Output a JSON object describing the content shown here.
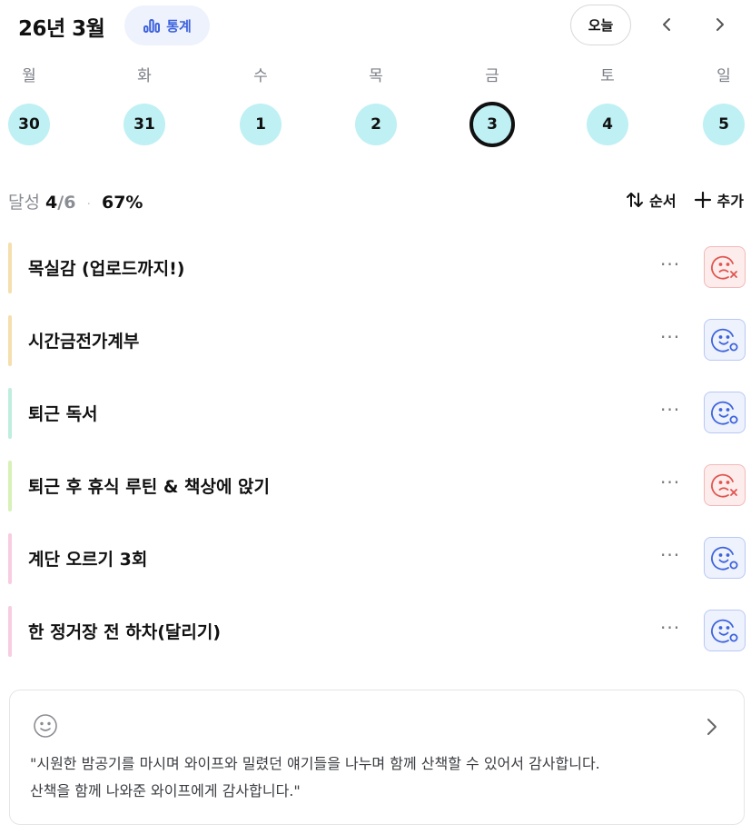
{
  "header": {
    "month_title": "26년 3월",
    "stats_label": "통계",
    "today_label": "오늘"
  },
  "week": {
    "days": [
      {
        "name": "월",
        "date": "30",
        "selected": false
      },
      {
        "name": "화",
        "date": "31",
        "selected": false
      },
      {
        "name": "수",
        "date": "1",
        "selected": false
      },
      {
        "name": "목",
        "date": "2",
        "selected": false
      },
      {
        "name": "금",
        "date": "3",
        "selected": true
      },
      {
        "name": "토",
        "date": "4",
        "selected": false
      },
      {
        "name": "일",
        "date": "5",
        "selected": false
      }
    ]
  },
  "summary": {
    "label": "달성",
    "done": "4",
    "total": "/6",
    "separator": "·",
    "percent": "67%"
  },
  "actions": {
    "order_label": "순서",
    "add_label": "추가"
  },
  "habits": [
    {
      "title": "목실감 (업로드까지!)",
      "more": "···",
      "status": "fail",
      "color": "#f6dfae"
    },
    {
      "title": "시간금전가계부",
      "more": "···",
      "status": "done",
      "color": "#f6dfae"
    },
    {
      "title": "퇴근 독서",
      "more": "···",
      "status": "done",
      "color": "#bfeede"
    },
    {
      "title": "퇴근 후 휴식 루틴 & 책상에 앉기",
      "more": "···",
      "status": "fail",
      "color": "#d8f1b8"
    },
    {
      "title": "계단 오르기 3회",
      "more": "···",
      "status": "done",
      "color": "#f8cde1"
    },
    {
      "title": "한 정거장 전 하차(달리기)",
      "more": "···",
      "status": "done",
      "color": "#f8cde1"
    }
  ],
  "gratitude": {
    "text": "\"시원한 밤공기를 마시며 와이프와 밀렸던 얘기들을 나누며 함께 산책할 수 있어서 감사합니다.\n산책을 함께 나와준 와이프에게 감사합니다.\""
  },
  "colors": {
    "accent_blue": "#3d63dd",
    "fail_red": "#e0554f",
    "day_circle": "#bff0f4"
  }
}
